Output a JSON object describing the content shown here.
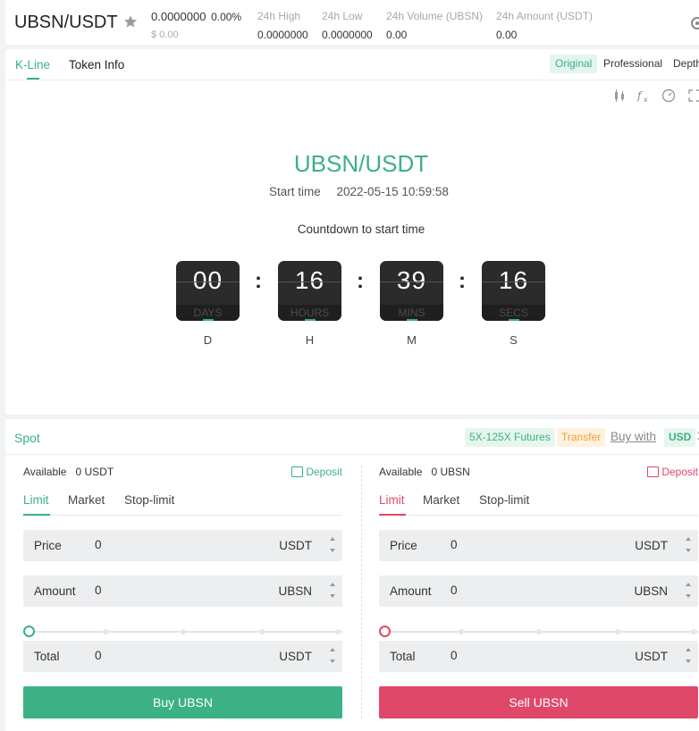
{
  "header": {
    "pair": "UBSN/USDT",
    "price": "0.0000000",
    "change": "0.00%",
    "price_usd": "$ 0.00",
    "stats": [
      {
        "label": "24h High",
        "value": "0.0000000"
      },
      {
        "label": "24h Low",
        "value": "0.0000000"
      },
      {
        "label": "24h Volume (UBSN)",
        "value": "0.00"
      },
      {
        "label": "24h Amount (USDT)",
        "value": "0.00"
      }
    ]
  },
  "chart": {
    "tabs": [
      "K-Line",
      "Token Info"
    ],
    "views": [
      "Original",
      "Professional",
      "Depth"
    ],
    "title": "UBSN/USDT",
    "start_label": "Start time",
    "start_value": "2022-05-15 10:59:58",
    "countdown_label": "Countdown to start time",
    "countdown": [
      {
        "value": "00",
        "unit": "DAYS",
        "letter": "D"
      },
      {
        "value": "16",
        "unit": "HOURS",
        "letter": "H"
      },
      {
        "value": "39",
        "unit": "MINS",
        "letter": "M"
      },
      {
        "value": "16",
        "unit": "SECS",
        "letter": "S"
      }
    ],
    "colon": ":"
  },
  "trade": {
    "spot_tab": "Spot",
    "futures_label": "5X-125X Futures",
    "transfer_label": "Transfer",
    "buy_with_label": "Buy with",
    "usd_label": "USD",
    "more": "X",
    "order_tabs": [
      "Limit",
      "Market",
      "Stop-limit"
    ],
    "buy": {
      "available_label": "Available",
      "available_value": "0 USDT",
      "deposit_label": "Deposit",
      "price_label": "Price",
      "price_value": "0",
      "price_unit": "USDT",
      "amount_label": "Amount",
      "amount_value": "0",
      "amount_unit": "UBSN",
      "total_label": "Total",
      "total_value": "0",
      "total_unit": "USDT",
      "slider_percent": 0,
      "button": "Buy UBSN"
    },
    "sell": {
      "available_label": "Available",
      "available_value": "0 UBSN",
      "deposit_label": "Deposit",
      "price_label": "Price",
      "price_value": "0",
      "price_unit": "USDT",
      "amount_label": "Amount",
      "amount_value": "0",
      "amount_unit": "UBSN",
      "total_label": "Total",
      "total_value": "0",
      "total_unit": "USDT",
      "slider_percent": 0,
      "button": "Sell UBSN"
    }
  },
  "colors": {
    "green": "#3bb185",
    "red": "#e0486a",
    "orange": "#f19f34"
  }
}
